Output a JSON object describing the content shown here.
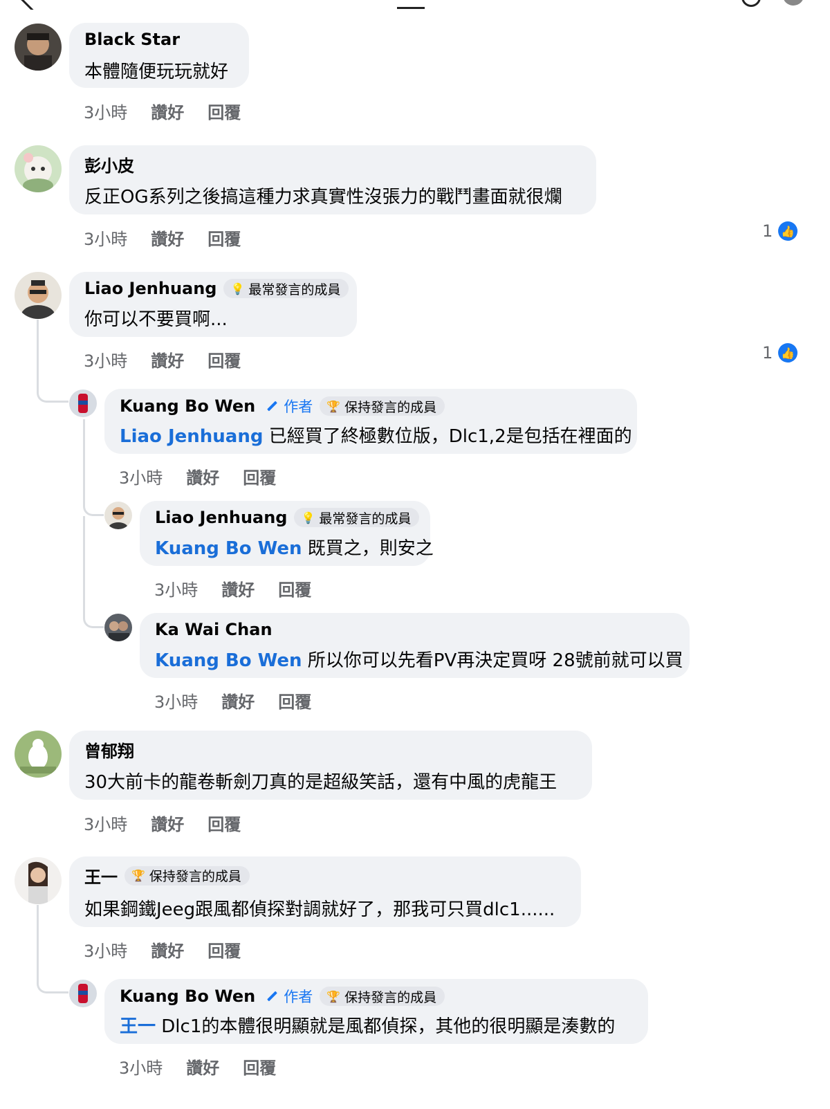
{
  "labels": {
    "like": "讚好",
    "reply": "回覆",
    "author": "作者"
  },
  "comments": [
    {
      "name": "Black Star",
      "text": "本體隨便玩玩就好",
      "time": "3小時"
    },
    {
      "name": "彭小皮",
      "text": "反正OG系列之後搞這種力求真實性沒張力的戰鬥畫面就很爛",
      "time": "3小時",
      "reactions": "1"
    },
    {
      "name": "Liao Jenhuang",
      "badge": "最常發言的成員",
      "text": "你可以不要買啊...",
      "time": "3小時",
      "reactions": "1"
    },
    {
      "name": "Kuang Bo Wen",
      "badge": "保持發言的成員",
      "mention": "Liao Jenhuang",
      "text": " 已經買了終極數位版，Dlc1,2是包括在裡面的",
      "time": "3小時"
    },
    {
      "name": "Liao Jenhuang",
      "badge": "最常發言的成員",
      "mention": "Kuang Bo Wen",
      "text": " 既買之，則安之",
      "time": "3小時"
    },
    {
      "name": "Ka Wai Chan",
      "mention": "Kuang Bo Wen",
      "text": " 所以你可以先看PV再決定買呀 28號前就可以買",
      "time": "3小時"
    },
    {
      "name": "曾郁翔",
      "text": "30大前卡的龍卷斬劍刀真的是超級笑話，還有中風的虎龍王",
      "time": "3小時"
    },
    {
      "name": "王一",
      "badge": "保持發言的成員",
      "text": "如果鋼鐵Jeeg跟風都偵探對調就好了，那我可只買dlc1......",
      "time": "3小時"
    },
    {
      "name": "Kuang Bo Wen",
      "badge": "保持發言的成員",
      "mention": "王一",
      "text": " Dlc1的本體很明顯就是風都偵探，其他的很明顯是湊數的",
      "time": "3小時"
    }
  ]
}
